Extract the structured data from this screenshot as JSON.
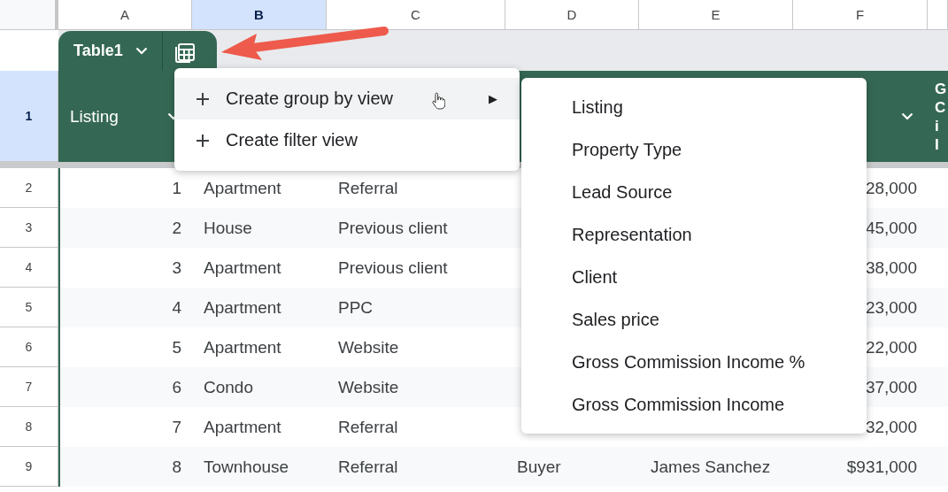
{
  "column_headers": [
    {
      "label": "A",
      "selected": false
    },
    {
      "label": "B",
      "selected": true
    },
    {
      "label": "C",
      "selected": false
    },
    {
      "label": "D",
      "selected": false
    },
    {
      "label": "E",
      "selected": false
    },
    {
      "label": "F",
      "selected": false
    }
  ],
  "table": {
    "name": "Table1",
    "header_row": {
      "number": "1",
      "selected": true,
      "listing": "Listing",
      "column_7": "G C i I"
    },
    "rows": [
      {
        "number": "2",
        "listing": "1",
        "property_type": "Apartment",
        "lead_source": "Referral",
        "sales_price": "28,000"
      },
      {
        "number": "3",
        "listing": "2",
        "property_type": "House",
        "lead_source": "Previous client",
        "sales_price": "45,000"
      },
      {
        "number": "4",
        "listing": "3",
        "property_type": "Apartment",
        "lead_source": "Previous client",
        "sales_price": "38,000"
      },
      {
        "number": "5",
        "listing": "4",
        "property_type": "Apartment",
        "lead_source": "PPC",
        "sales_price": "23,000"
      },
      {
        "number": "6",
        "listing": "5",
        "property_type": "Apartment",
        "lead_source": "Website",
        "sales_price": "22,000"
      },
      {
        "number": "7",
        "listing": "6",
        "property_type": "Condo",
        "lead_source": "Website",
        "sales_price": "37,000"
      },
      {
        "number": "8",
        "listing": "7",
        "property_type": "Apartment",
        "lead_source": "Referral",
        "sales_price": "32,000"
      },
      {
        "number": "9",
        "listing": "8",
        "property_type": "Townhouse",
        "lead_source": "Referral",
        "representation": "Buyer",
        "client": "James Sanchez",
        "sales_price": "$931,000"
      }
    ]
  },
  "menu": {
    "items": [
      {
        "label": "Create group by view",
        "hovered": true,
        "submenu_arrow": "▶"
      },
      {
        "label": "Create filter view",
        "hovered": false
      }
    ]
  },
  "submenu": {
    "items": [
      "Listing",
      "Property Type",
      "Lead Source",
      "Representation",
      "Client",
      "Sales price",
      "Gross Commission Income %",
      "Gross Commission Income"
    ]
  }
}
